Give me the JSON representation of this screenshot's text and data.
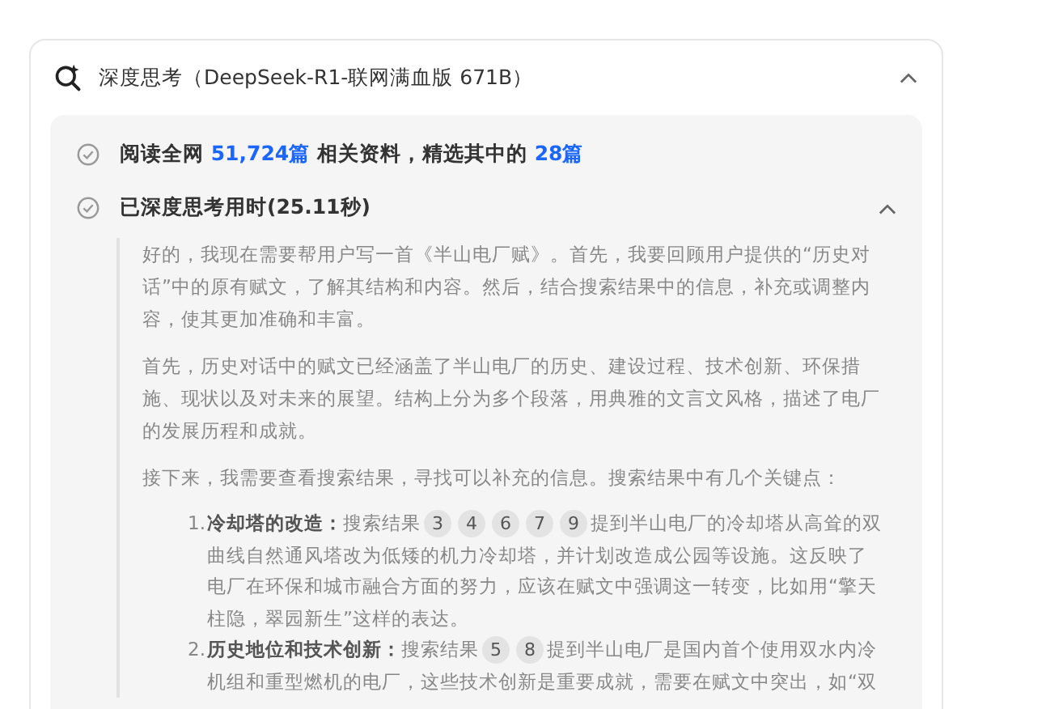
{
  "header": {
    "title": "深度思考（DeepSeek-R1-联网满血版 671B）",
    "expanded": true
  },
  "steps": [
    {
      "kind": "read",
      "parts": [
        {
          "text": "阅读全网 ",
          "highlight": false
        },
        {
          "text": "51,724篇",
          "highlight": true
        },
        {
          "text": " 相关资料，精选其中的 ",
          "highlight": false
        },
        {
          "text": "28篇",
          "highlight": true
        }
      ]
    },
    {
      "kind": "thinking",
      "parts": [
        {
          "text": "已深度思考用时(25.11秒)",
          "highlight": false
        }
      ],
      "expanded": true
    }
  ],
  "thought": {
    "paragraphs": [
      "好的，我现在需要帮用户写一首《半山电厂赋》。首先，我要回顾用户提供的“历史对话”中的原有赋文，了解其结构和内容。然后，结合搜索结果中的信息，补充或调整内容，使其更加准确和丰富。",
      "首先，历史对话中的赋文已经涵盖了半山电厂的历史、建设过程、技术创新、环保措施、现状以及对未来的展望。结构上分为多个段落，用典雅的文言文风格，描述了电厂的发展历程和成就。",
      "接下来，我需要查看搜索结果，寻找可以补充的信息。搜索结果中有几个关键点："
    ],
    "points": [
      {
        "number": "1.",
        "title": "冷却塔的改造：",
        "lead": "搜索结果",
        "citations": [
          "3",
          "4",
          "6",
          "7",
          "9"
        ],
        "text": "提到半山电厂的冷却塔从高耸的双曲线自然通风塔改为低矮的机力冷却塔，并计划改造成公园等设施。这反映了电厂在环保和城市融合方面的努力，应该在赋文中强调这一转变，比如用“擎天柱隐，翠园新生”这样的表达。"
      },
      {
        "number": "2.",
        "title": "历史地位和技术创新：",
        "lead": "搜索结果",
        "citations": [
          "5",
          "8"
        ],
        "text": "提到半山电厂是国内首个使用双水内冷机组和重型燃机的电厂，这些技术创新是重要成就，需要在赋文中突出，如“双"
      }
    ]
  }
}
